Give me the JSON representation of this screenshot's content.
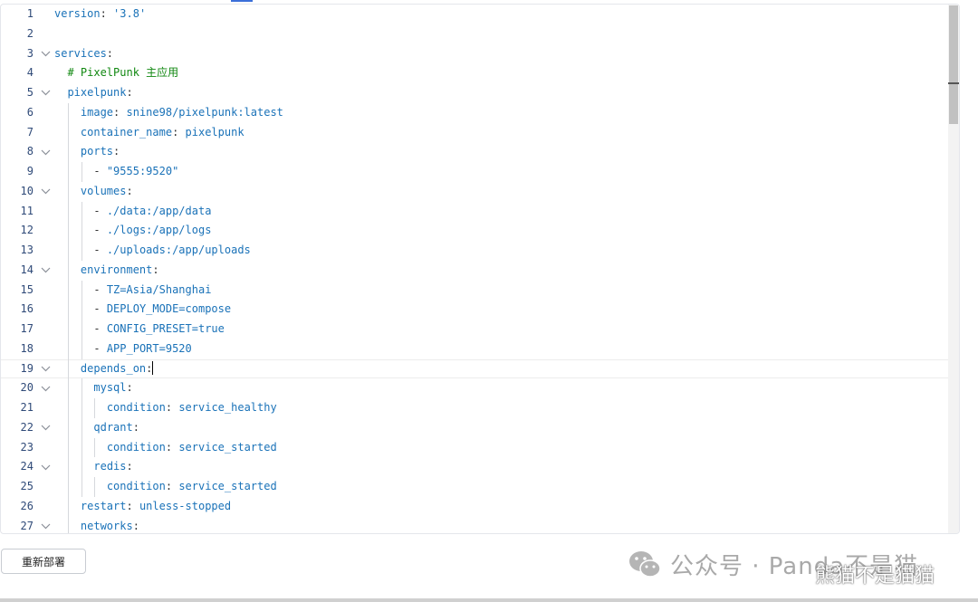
{
  "editor": {
    "lines": [
      {
        "n": "1",
        "indent": 0,
        "key": "version",
        "val": "'3.8'"
      },
      {
        "n": "2",
        "indent": 0
      },
      {
        "n": "3",
        "indent": 0,
        "fold": true,
        "key": "services"
      },
      {
        "n": "4",
        "indent": 1,
        "comment": "# PixelPunk 主应用"
      },
      {
        "n": "5",
        "indent": 1,
        "fold": true,
        "key": "pixelpunk"
      },
      {
        "n": "6",
        "indent": 2,
        "key": "image",
        "val": "snine98/pixelpunk:latest"
      },
      {
        "n": "7",
        "indent": 2,
        "key": "container_name",
        "val": "pixelpunk"
      },
      {
        "n": "8",
        "indent": 2,
        "fold": true,
        "key": "ports"
      },
      {
        "n": "9",
        "indent": 3,
        "item": "\"9555:9520\""
      },
      {
        "n": "10",
        "indent": 2,
        "fold": true,
        "key": "volumes"
      },
      {
        "n": "11",
        "indent": 3,
        "item": "./data:/app/data"
      },
      {
        "n": "12",
        "indent": 3,
        "item": "./logs:/app/logs"
      },
      {
        "n": "13",
        "indent": 3,
        "item": "./uploads:/app/uploads"
      },
      {
        "n": "14",
        "indent": 2,
        "fold": true,
        "key": "environment"
      },
      {
        "n": "15",
        "indent": 3,
        "item": "TZ=Asia/Shanghai"
      },
      {
        "n": "16",
        "indent": 3,
        "item": "DEPLOY_MODE=compose"
      },
      {
        "n": "17",
        "indent": 3,
        "item": "CONFIG_PRESET=true"
      },
      {
        "n": "18",
        "indent": 3,
        "item": "APP_PORT=9520"
      },
      {
        "n": "19",
        "indent": 2,
        "fold": true,
        "key": "depends_on",
        "active": true
      },
      {
        "n": "20",
        "indent": 3,
        "fold": true,
        "key": "mysql"
      },
      {
        "n": "21",
        "indent": 4,
        "key": "condition",
        "val": "service_healthy"
      },
      {
        "n": "22",
        "indent": 3,
        "fold": true,
        "key": "qdrant"
      },
      {
        "n": "23",
        "indent": 4,
        "key": "condition",
        "val": "service_started"
      },
      {
        "n": "24",
        "indent": 3,
        "fold": true,
        "key": "redis"
      },
      {
        "n": "25",
        "indent": 4,
        "key": "condition",
        "val": "service_started"
      },
      {
        "n": "26",
        "indent": 2,
        "key": "restart",
        "val": "unless-stopped"
      },
      {
        "n": "27",
        "indent": 2,
        "fold": true,
        "key": "networks"
      }
    ]
  },
  "actions": {
    "redeploy_label": "重新部署"
  },
  "watermark": {
    "text": "公众号 · Panda不是猫",
    "sub": "熊猫不是猫猫"
  },
  "colors": {
    "key": "#1a72b8",
    "comment": "#118811",
    "line_number": "#2f4a78"
  }
}
